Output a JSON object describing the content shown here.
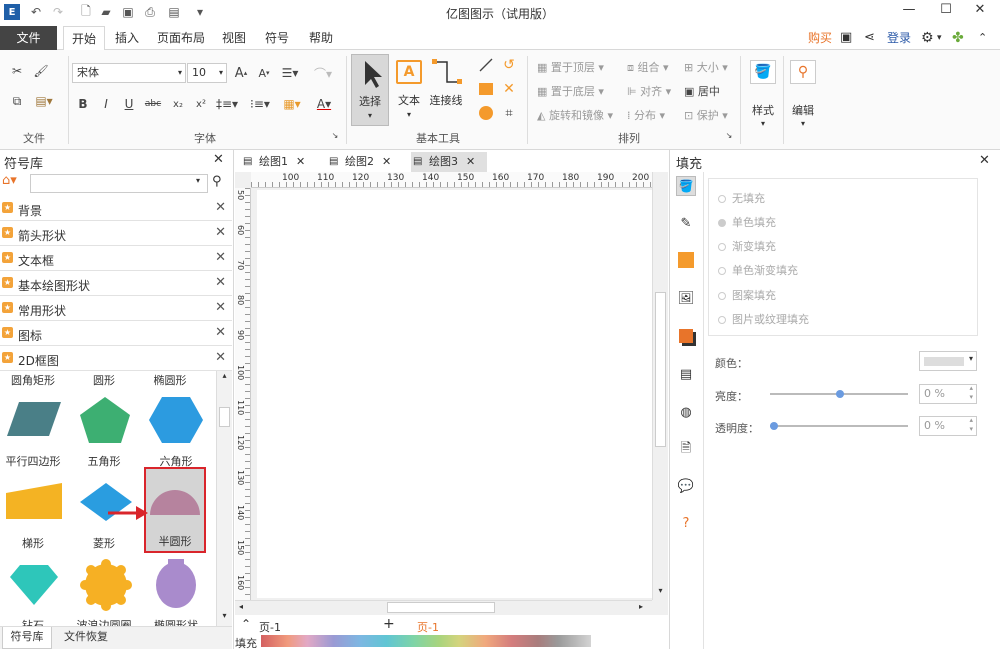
{
  "app": {
    "title": "亿图图示（试用版）"
  },
  "menu": {
    "file": "文件",
    "items": [
      "开始",
      "插入",
      "页面布局",
      "视图",
      "符号",
      "帮助"
    ],
    "buy": "购买",
    "login": "登录"
  },
  "ribbon": {
    "font_name": "宋体",
    "font_size": "10",
    "group_labels": {
      "file": "文件",
      "font": "字体",
      "basic_tools": "基本工具",
      "arrange": "排列"
    },
    "tools": {
      "select": "选择",
      "text": "文本",
      "connector": "连接线"
    },
    "arrange": {
      "top": "置于顶层",
      "bottom": "置于底层",
      "rotate": "旋转和镜像",
      "group": "组合",
      "align": "对齐",
      "distribute": "分布",
      "size": "大小",
      "center": "居中",
      "protect": "保护"
    },
    "style": "样式",
    "edit": "编辑"
  },
  "library": {
    "title": "符号库",
    "search_placeholder": "",
    "items": [
      "背景",
      "箭头形状",
      "文本框",
      "基本绘图形状",
      "常用形状",
      "图标",
      "2D框图"
    ],
    "partial_row": [
      "圆角矩形",
      "圆形",
      "椭圆形"
    ],
    "shapes": [
      "平行四边形",
      "五角形",
      "六角形",
      "梯形",
      "菱形",
      "半圆形",
      "钻石",
      "波浪边圆圈",
      "椭圆形状"
    ],
    "bottom_tabs": [
      "符号库",
      "文件恢复"
    ]
  },
  "tabs": [
    "绘图1",
    "绘图2",
    "绘图3"
  ],
  "ruler": {
    "h": [
      "100",
      "110",
      "120",
      "130",
      "140",
      "150",
      "160",
      "170",
      "180",
      "190",
      "200"
    ],
    "v": [
      "50",
      "60",
      "70",
      "80",
      "90",
      "100",
      "110",
      "120",
      "130",
      "140",
      "150",
      "160",
      "170",
      "180",
      "190"
    ]
  },
  "status": {
    "page": "页-1",
    "page_active": "页-1",
    "fill": "填充"
  },
  "fill_panel": {
    "title": "填充",
    "options": [
      "无填充",
      "单色填充",
      "渐变填充",
      "单色渐变填充",
      "图案填充",
      "图片或纹理填充"
    ],
    "color_label": "颜色：",
    "brightness_label": "亮度：",
    "brightness_value": "0 %",
    "transparency_label": "透明度：",
    "transparency_value": "0 %"
  },
  "colors": {
    "accent": "#f49a2c",
    "highlight": "#d9252b",
    "dark_menu": "#444444"
  }
}
